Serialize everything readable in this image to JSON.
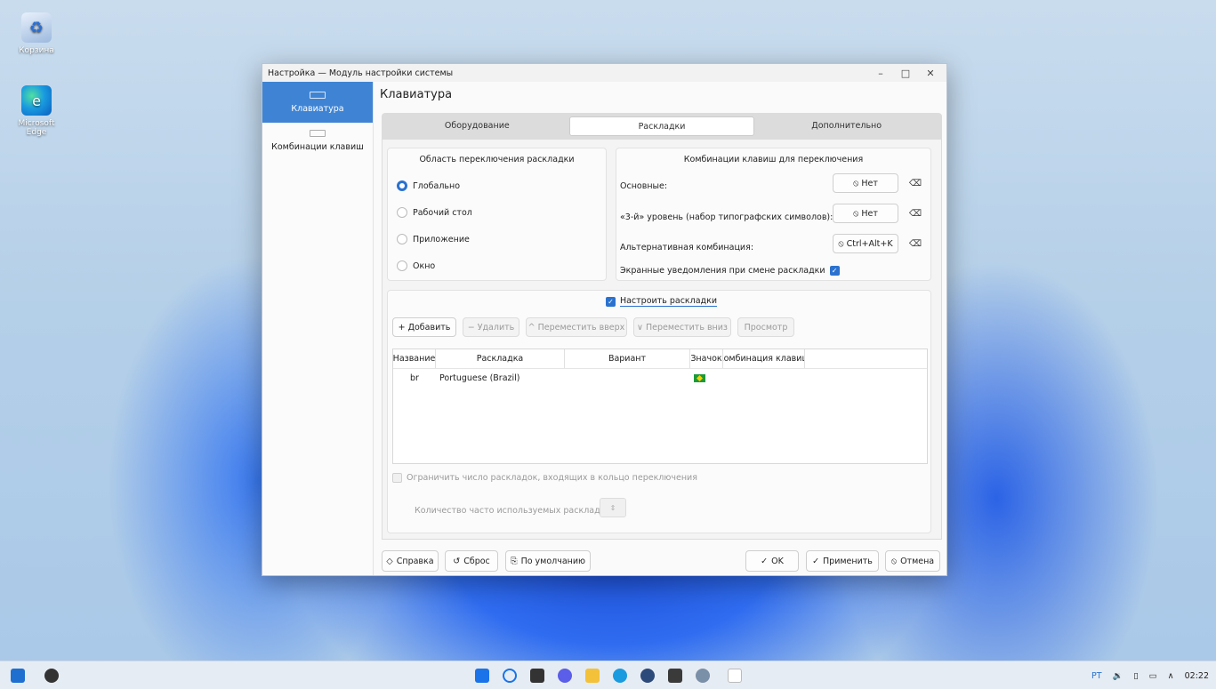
{
  "desktop": {
    "icons": [
      {
        "label": "Корзина"
      },
      {
        "label": "Microsoft Edge"
      }
    ]
  },
  "window": {
    "title": "Настройка — Модуль настройки системы",
    "controls": {
      "minimize": "–",
      "maximize": "□",
      "close": "✕"
    }
  },
  "sidebar": {
    "items": [
      {
        "label": "Клавиатура"
      },
      {
        "label": "Комбинации клавиш"
      }
    ]
  },
  "page": {
    "title": "Клавиатура"
  },
  "tabs": [
    {
      "label": "Оборудование"
    },
    {
      "label": "Раскладки"
    },
    {
      "label": "Дополнительно"
    }
  ],
  "switch_area": {
    "title": "Область переключения раскладки",
    "options": [
      {
        "label": "Глобально",
        "selected": true
      },
      {
        "label": "Рабочий стол",
        "selected": false
      },
      {
        "label": "Приложение",
        "selected": false
      },
      {
        "label": "Окно",
        "selected": false
      }
    ]
  },
  "shortcuts": {
    "title": "Комбинации клавиш для переключения",
    "rows": [
      {
        "label": "Основные:",
        "value": "Нет"
      },
      {
        "label": "«3-й» уровень (набор типографских символов):",
        "value": "Нет"
      },
      {
        "label": "Альтернативная комбинация:",
        "value": "Ctrl+Alt+K"
      }
    ],
    "notify_label": "Экранные уведомления при смене раскладки"
  },
  "layouts": {
    "configure_label": "Настроить раскладки",
    "buttons": {
      "add": "+ Добавить",
      "remove": "− Удалить",
      "move_up": "^ Переместить вверх",
      "move_down": "∨ Переместить вниз",
      "preview": "Просмотр"
    },
    "columns": [
      "Название",
      "Раскладка",
      "Вариант",
      "Значок",
      "Комбинация клавиш"
    ],
    "rows": [
      {
        "name": "br",
        "layout": "Portuguese (Brazil)",
        "variant": "",
        "shortcut": ""
      }
    ],
    "limit_label": "Ограничить число раскладок, входящих в кольцо переключения",
    "count_label": "Количество часто используемых раскладок:"
  },
  "footer": {
    "help": "Справка",
    "reset": "Сброс",
    "defaults": "По умолчанию",
    "ok": "OK",
    "apply": "Применить",
    "cancel": "Отмена"
  },
  "taskbar": {
    "lang": "PT",
    "time": "02:22"
  }
}
